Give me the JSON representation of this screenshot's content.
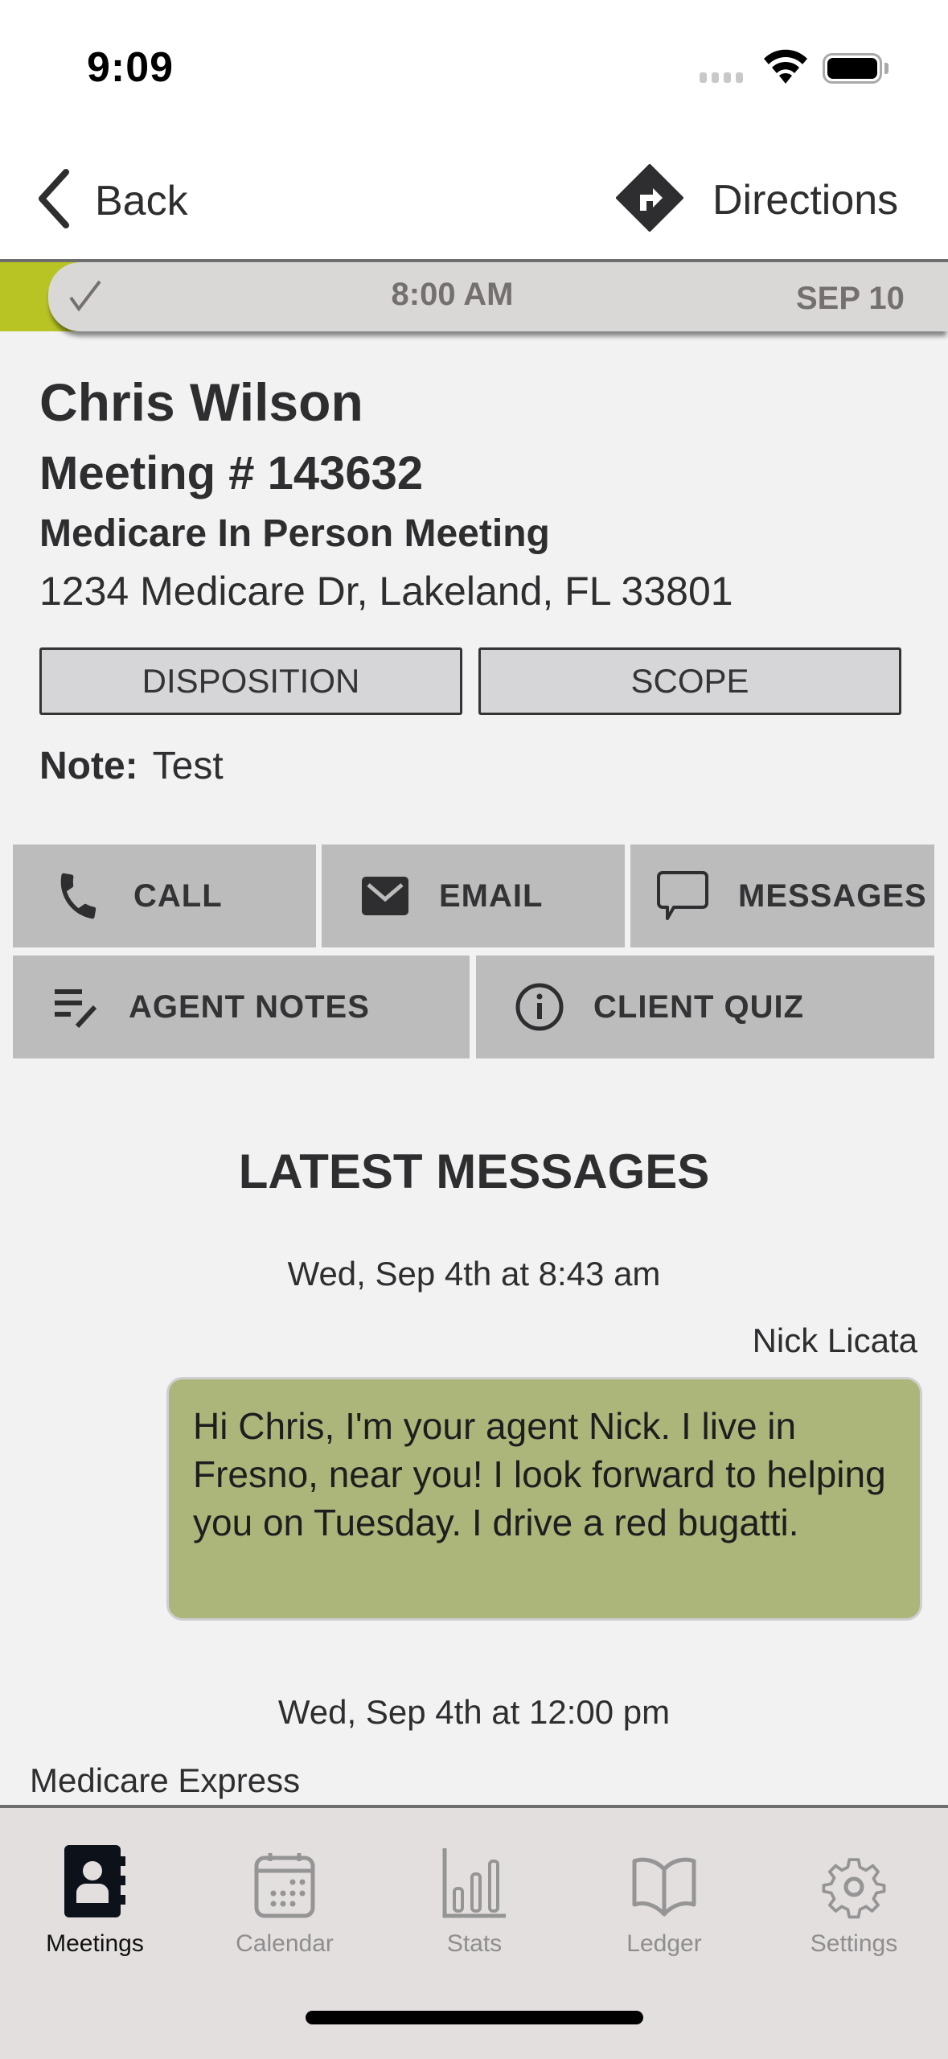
{
  "status_bar": {
    "time": "9:09"
  },
  "nav": {
    "back_label": "Back",
    "directions_label": "Directions"
  },
  "appointment_strip": {
    "status_icon": "checkmark-icon",
    "time": "8:00 AM",
    "date": "SEP 10",
    "accent_color": "#b8c424"
  },
  "meeting": {
    "client_name": "Chris Wilson",
    "meeting_number": "Meeting # 143632",
    "meeting_type": "Medicare In Person Meeting",
    "address": "1234 Medicare Dr, Lakeland,  FL 33801",
    "note_label": "Note:",
    "note_value": "Test"
  },
  "buttons": {
    "disposition": "DISPOSITION",
    "scope": "SCOPE"
  },
  "actions": [
    {
      "label": "CALL",
      "icon": "phone-icon"
    },
    {
      "label": "EMAIL",
      "icon": "mail-icon"
    },
    {
      "label": "MESSAGES",
      "icon": "chat-bubble-icon"
    },
    {
      "label": "AGENT NOTES",
      "icon": "notes-edit-icon"
    },
    {
      "label": "CLIENT QUIZ",
      "icon": "info-icon"
    }
  ],
  "messages": {
    "title": "LATEST MESSAGES",
    "items": [
      {
        "timestamp": "Wed, Sep 4th at 8:43 am",
        "sender": "Nick Licata",
        "text": "Hi Chris, I'm your agent Nick. I live in Fresno, near you! I look forward to helping you on Tuesday. I drive a red bugatti.",
        "bubble_color": "#adb67a"
      },
      {
        "timestamp": "Wed, Sep 4th at 12:00 pm",
        "sender": "Medicare Express"
      }
    ]
  },
  "tab_bar": {
    "active": "Meetings",
    "tabs": [
      {
        "label": "Meetings",
        "icon": "contacts-book-icon"
      },
      {
        "label": "Calendar",
        "icon": "calendar-icon"
      },
      {
        "label": "Stats",
        "icon": "bar-chart-icon"
      },
      {
        "label": "Ledger",
        "icon": "open-book-icon"
      },
      {
        "label": "Settings",
        "icon": "gear-icon"
      }
    ]
  }
}
